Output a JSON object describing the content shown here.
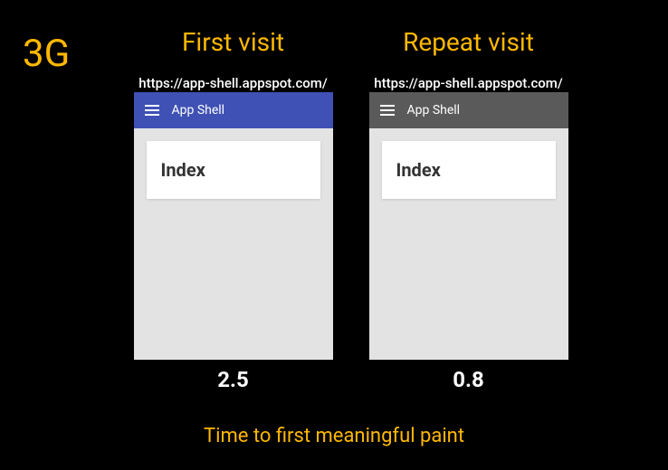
{
  "networkLabel": "3G",
  "caption": "Time to first meaningful paint",
  "columns": {
    "left": {
      "heading": "First visit",
      "url": "https://app-shell.appspot.com/",
      "appBarTitle": "App Shell",
      "cardText": "Index",
      "timing": "2.5"
    },
    "right": {
      "heading": "Repeat visit",
      "url": "https://app-shell.appspot.com/",
      "appBarTitle": "App Shell",
      "cardText": "Index",
      "timing": "0.8"
    }
  }
}
